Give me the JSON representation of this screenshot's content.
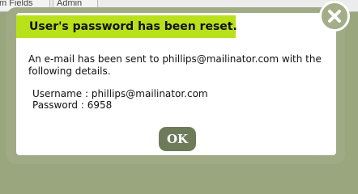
{
  "background_tabs": [
    {
      "label": "m Fields"
    },
    {
      "label": "Admin"
    }
  ],
  "dialog": {
    "title": "User's password has been reset.",
    "message": "An e-mail has been sent to phillips@mailinator.com with the following details.",
    "username_label": "Username : ",
    "username_value": "phillips@mailinator.com",
    "password_label": "Password : ",
    "password_value": "6958",
    "ok_label": "OK",
    "close_icon": "close-icon"
  },
  "colors": {
    "title_bar": "#b8e11b",
    "frame": "#a0ab85",
    "ok_button": "#6d7b5b"
  }
}
